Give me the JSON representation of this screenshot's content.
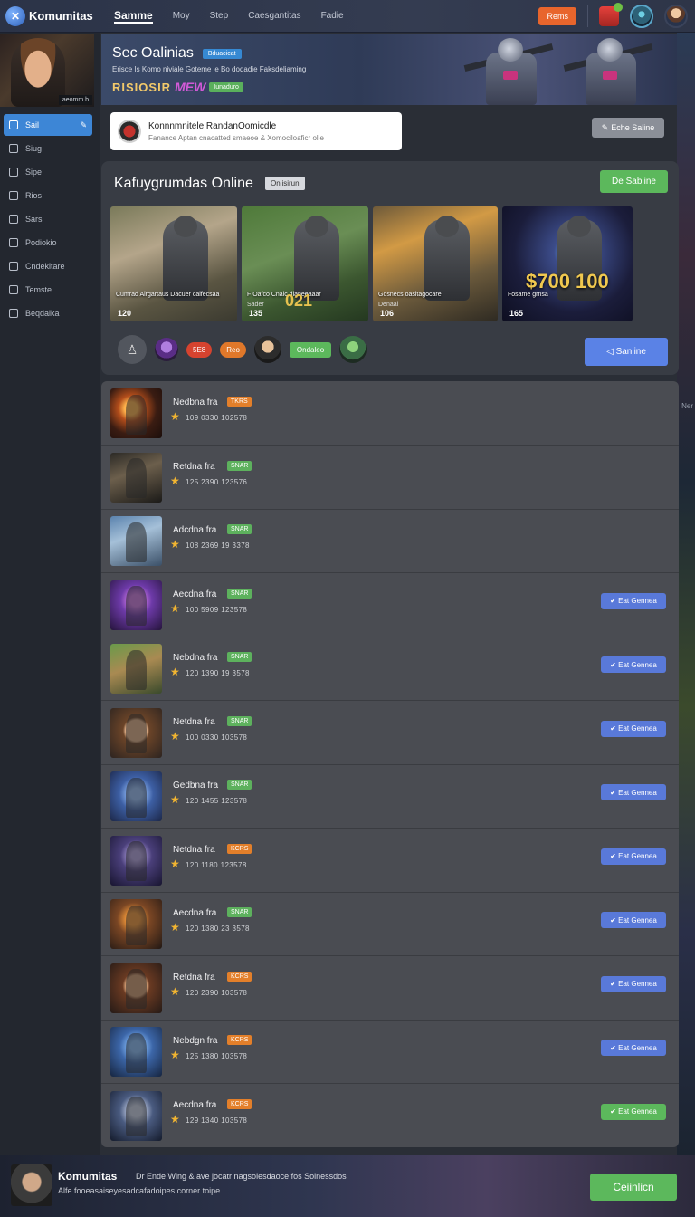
{
  "topbar": {
    "logo_text": "Komumitas",
    "nav": [
      "Samme",
      "Moy",
      "Step",
      "Caesgantitas",
      "Fadie"
    ],
    "action_label": "Rems"
  },
  "sidebar": {
    "profile_tag": "aeomm.b",
    "items": [
      {
        "label": "Sail",
        "active": true,
        "icon": "home-icon"
      },
      {
        "label": "Siug",
        "icon": "group-icon"
      },
      {
        "label": "Sipe",
        "icon": "share-icon"
      },
      {
        "label": "Rios",
        "icon": "file-icon"
      },
      {
        "label": "Sars",
        "icon": "controller-icon"
      },
      {
        "label": "Podiokio",
        "icon": "chat-icon"
      },
      {
        "label": "Cndekitare",
        "icon": "link-icon"
      },
      {
        "label": "Temste",
        "icon": "box-icon"
      },
      {
        "label": "Beqdaika",
        "icon": "folder-icon"
      }
    ]
  },
  "banner": {
    "title": "Sec Oalinias",
    "badge": "Bduacicat",
    "subtitle": "Erisce Is Komo niviale Goteme ie Bo doqadie Faksdeliaming",
    "tag1": "RISIOSIR",
    "tag2": "MEW",
    "tag3": "Iunaduro"
  },
  "search": {
    "title": "Konnnmnitele RandanOomicdle",
    "subtitle": "Fanance Aptan cnacatted smaeoe & Xomociloaficr olie"
  },
  "edit_button": "Eche Saline",
  "featured": {
    "title": "Kafuygrumdas Online",
    "badge": "Onlisirun",
    "top_button": "De Sabline",
    "cards": [
      {
        "caption": "Cumrad Alrgartaus Dacuer caifecsaa",
        "sub": "",
        "num": "120",
        "big": ""
      },
      {
        "caption": "F Oafco Cnalc dlaneeaaar",
        "sub": "Sader",
        "num": "135",
        "big": "021"
      },
      {
        "caption": "Gosnecs oasitagocare",
        "sub": "Denaal",
        "num": "106",
        "big": ""
      },
      {
        "caption": "Fosame grnsa",
        "sub": "",
        "num": "165",
        "big": "",
        "price": "$700 100"
      }
    ],
    "pills": [
      "5E8",
      "Reo",
      "Ondaleo"
    ],
    "send_button": "Sanline"
  },
  "list": [
    {
      "name": "Nedbna fra",
      "tag": "TKRS",
      "tag_color": "orange",
      "stat": "109 0330 102578",
      "action": ""
    },
    {
      "name": "Retdna fra",
      "tag": "SNAR",
      "tag_color": "green",
      "stat": "125 2390 123576",
      "action": ""
    },
    {
      "name": "Adcdna fra",
      "tag": "SNAR",
      "tag_color": "green",
      "stat": "108 2369 19 3378",
      "action": ""
    },
    {
      "name": "Aecdna fra",
      "tag": "SNAR",
      "tag_color": "green",
      "stat": "100 5909 123578",
      "action": "Eat Gennea",
      "action_color": "blue"
    },
    {
      "name": "Nebdna fra",
      "tag": "SNAR",
      "tag_color": "green",
      "stat": "120 1390 19 3578",
      "action": "Eat Gennea",
      "action_color": "blue"
    },
    {
      "name": "Netdna fra",
      "tag": "SNAR",
      "tag_color": "green",
      "stat": "100 0330 103578",
      "action": "Eat Gennea",
      "action_color": "blue"
    },
    {
      "name": "Gedbna fra",
      "tag": "SNAR",
      "tag_color": "green",
      "stat": "120 1455 123578",
      "action": "Eat Gennea",
      "action_color": "blue"
    },
    {
      "name": "Netdna fra",
      "tag": "KCRS",
      "tag_color": "orange",
      "stat": "120 1180 123578",
      "action": "Eat Gennea",
      "action_color": "blue"
    },
    {
      "name": "Aecdna fra",
      "tag": "SNAR",
      "tag_color": "green",
      "stat": "120 1380 23 3578",
      "action": "Eat Gennea",
      "action_color": "blue"
    },
    {
      "name": "Retdna fra",
      "tag": "KCRS",
      "tag_color": "orange",
      "stat": "120 2390 103578",
      "action": "Eat Gennea",
      "action_color": "blue"
    },
    {
      "name": "Nebdgn fra",
      "tag": "KCRS",
      "tag_color": "orange",
      "stat": "125 1380 103578",
      "action": "Eat Gennea",
      "action_color": "blue"
    },
    {
      "name": "Aecdna fra",
      "tag": "KCRS",
      "tag_color": "orange",
      "stat": "129 1340 103578",
      "action": "Eat Gennea",
      "action_color": "green"
    }
  ],
  "right_label": "Ner",
  "bottom": {
    "title": "Komumitas",
    "text1": "Dr Ende Wing & ave jocatr nagsolesdaoce fos Solnessdos",
    "text2": "Alfe fooeasaiseyesadcafadoipes corner toipe",
    "button": "Ceiinlicn"
  },
  "colors": {
    "accent": "#3d86d6",
    "success": "#5cb85c",
    "warning": "#e8652c",
    "action_blue": "#5979d9"
  }
}
